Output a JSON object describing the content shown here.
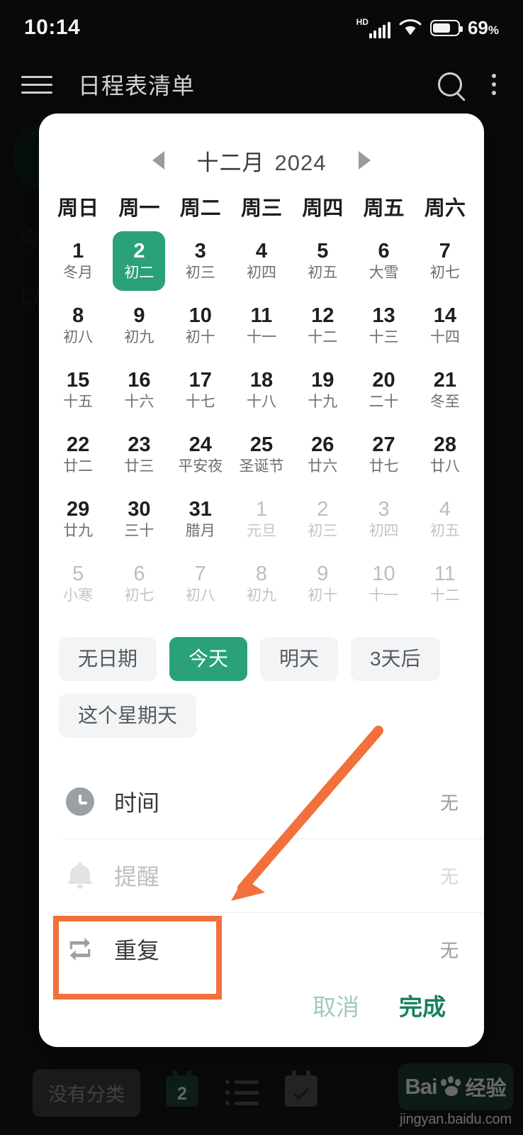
{
  "status_bar": {
    "time": "10:14",
    "network_tag": "HD",
    "battery_percent": "69",
    "percent_unit": "%",
    "signal_icon": "signal-bars-icon",
    "wifi_icon": "wifi-icon",
    "battery_icon": "battery-icon"
  },
  "app_bar": {
    "menu_icon": "hamburger-menu-icon",
    "title": "日程表清单",
    "search_icon": "search-icon",
    "overflow_icon": "kebab-menu-icon"
  },
  "background": {
    "line1": "今",
    "line2": "以",
    "bottom_bar": {
      "category_chip": "没有分类",
      "calendar_day": "2",
      "calendar_icon": "calendar-icon",
      "list_icon": "list-icon",
      "task_icon": "calendar-check-icon"
    }
  },
  "watermark": {
    "brand": "Bai",
    "suffix": "经验",
    "paw_icon": "baidu-paw-icon",
    "url": "jingyan.baidu.com"
  },
  "dialog": {
    "month_header": {
      "prev_icon": "chevron-left-icon",
      "month": "十二月",
      "year": "2024",
      "next_icon": "chevron-right-icon"
    },
    "weekdays": [
      "周日",
      "周一",
      "周二",
      "周三",
      "周四",
      "周五",
      "周六"
    ],
    "days": [
      {
        "num": "1",
        "lunar": "冬月",
        "state": "normal"
      },
      {
        "num": "2",
        "lunar": "初二",
        "state": "selected"
      },
      {
        "num": "3",
        "lunar": "初三",
        "state": "normal"
      },
      {
        "num": "4",
        "lunar": "初四",
        "state": "normal"
      },
      {
        "num": "5",
        "lunar": "初五",
        "state": "normal"
      },
      {
        "num": "6",
        "lunar": "大雪",
        "state": "normal"
      },
      {
        "num": "7",
        "lunar": "初七",
        "state": "normal"
      },
      {
        "num": "8",
        "lunar": "初八",
        "state": "normal"
      },
      {
        "num": "9",
        "lunar": "初九",
        "state": "normal"
      },
      {
        "num": "10",
        "lunar": "初十",
        "state": "normal"
      },
      {
        "num": "11",
        "lunar": "十一",
        "state": "normal"
      },
      {
        "num": "12",
        "lunar": "十二",
        "state": "normal"
      },
      {
        "num": "13",
        "lunar": "十三",
        "state": "normal"
      },
      {
        "num": "14",
        "lunar": "十四",
        "state": "normal"
      },
      {
        "num": "15",
        "lunar": "十五",
        "state": "normal"
      },
      {
        "num": "16",
        "lunar": "十六",
        "state": "normal"
      },
      {
        "num": "17",
        "lunar": "十七",
        "state": "normal"
      },
      {
        "num": "18",
        "lunar": "十八",
        "state": "normal"
      },
      {
        "num": "19",
        "lunar": "十九",
        "state": "normal"
      },
      {
        "num": "20",
        "lunar": "二十",
        "state": "normal"
      },
      {
        "num": "21",
        "lunar": "冬至",
        "state": "normal"
      },
      {
        "num": "22",
        "lunar": "廿二",
        "state": "normal"
      },
      {
        "num": "23",
        "lunar": "廿三",
        "state": "normal"
      },
      {
        "num": "24",
        "lunar": "平安夜",
        "state": "normal"
      },
      {
        "num": "25",
        "lunar": "圣诞节",
        "state": "normal"
      },
      {
        "num": "26",
        "lunar": "廿六",
        "state": "normal"
      },
      {
        "num": "27",
        "lunar": "廿七",
        "state": "normal"
      },
      {
        "num": "28",
        "lunar": "廿八",
        "state": "normal"
      },
      {
        "num": "29",
        "lunar": "廿九",
        "state": "normal"
      },
      {
        "num": "30",
        "lunar": "三十",
        "state": "normal"
      },
      {
        "num": "31",
        "lunar": "腊月",
        "state": "normal"
      },
      {
        "num": "1",
        "lunar": "元旦",
        "state": "muted"
      },
      {
        "num": "2",
        "lunar": "初三",
        "state": "muted"
      },
      {
        "num": "3",
        "lunar": "初四",
        "state": "muted"
      },
      {
        "num": "4",
        "lunar": "初五",
        "state": "muted"
      },
      {
        "num": "5",
        "lunar": "小寒",
        "state": "muted"
      },
      {
        "num": "6",
        "lunar": "初七",
        "state": "muted"
      },
      {
        "num": "7",
        "lunar": "初八",
        "state": "muted"
      },
      {
        "num": "8",
        "lunar": "初九",
        "state": "muted"
      },
      {
        "num": "9",
        "lunar": "初十",
        "state": "muted"
      },
      {
        "num": "10",
        "lunar": "十一",
        "state": "muted"
      },
      {
        "num": "11",
        "lunar": "十二",
        "state": "muted"
      }
    ],
    "quick_chips": [
      {
        "label": "无日期",
        "state": "normal"
      },
      {
        "label": "今天",
        "state": "active"
      },
      {
        "label": "明天",
        "state": "normal"
      },
      {
        "label": "3天后",
        "state": "normal"
      },
      {
        "label": "这个星期天",
        "state": "normal"
      }
    ],
    "option_rows": [
      {
        "icon": "clock-icon",
        "label": "时间",
        "value": "无",
        "state": "normal"
      },
      {
        "icon": "bell-icon",
        "label": "提醒",
        "value": "无",
        "state": "disabled"
      },
      {
        "icon": "repeat-icon",
        "label": "重复",
        "value": "无",
        "state": "normal"
      }
    ],
    "footer": {
      "cancel_label": "取消",
      "done_label": "完成"
    }
  },
  "annotation": {
    "arrow_icon": "arrow-pointer-icon",
    "highlight_target": "重复",
    "color": "#f2703c"
  },
  "colors": {
    "accent_green": "#2aa17a",
    "done_green": "#17815d",
    "cancel_green": "#9fcbbb",
    "annotation_orange": "#f2703c",
    "dialog_bg": "#ffffff",
    "chip_bg": "#f3f4f5"
  }
}
